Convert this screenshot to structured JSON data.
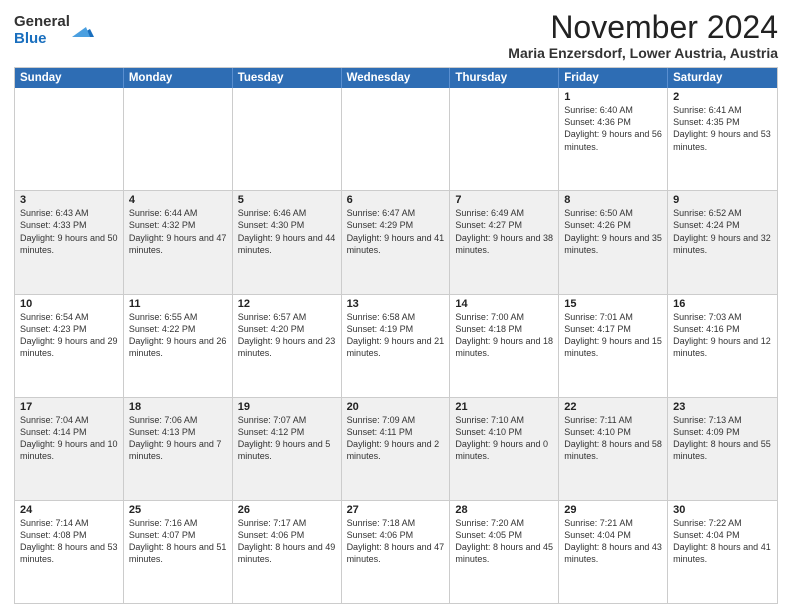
{
  "logo": {
    "general": "General",
    "blue": "Blue"
  },
  "header": {
    "month": "November 2024",
    "location": "Maria Enzersdorf, Lower Austria, Austria"
  },
  "weekdays": [
    "Sunday",
    "Monday",
    "Tuesday",
    "Wednesday",
    "Thursday",
    "Friday",
    "Saturday"
  ],
  "rows": [
    [
      {
        "day": "",
        "info": ""
      },
      {
        "day": "",
        "info": ""
      },
      {
        "day": "",
        "info": ""
      },
      {
        "day": "",
        "info": ""
      },
      {
        "day": "",
        "info": ""
      },
      {
        "day": "1",
        "info": "Sunrise: 6:40 AM\nSunset: 4:36 PM\nDaylight: 9 hours and 56 minutes."
      },
      {
        "day": "2",
        "info": "Sunrise: 6:41 AM\nSunset: 4:35 PM\nDaylight: 9 hours and 53 minutes."
      }
    ],
    [
      {
        "day": "3",
        "info": "Sunrise: 6:43 AM\nSunset: 4:33 PM\nDaylight: 9 hours and 50 minutes."
      },
      {
        "day": "4",
        "info": "Sunrise: 6:44 AM\nSunset: 4:32 PM\nDaylight: 9 hours and 47 minutes."
      },
      {
        "day": "5",
        "info": "Sunrise: 6:46 AM\nSunset: 4:30 PM\nDaylight: 9 hours and 44 minutes."
      },
      {
        "day": "6",
        "info": "Sunrise: 6:47 AM\nSunset: 4:29 PM\nDaylight: 9 hours and 41 minutes."
      },
      {
        "day": "7",
        "info": "Sunrise: 6:49 AM\nSunset: 4:27 PM\nDaylight: 9 hours and 38 minutes."
      },
      {
        "day": "8",
        "info": "Sunrise: 6:50 AM\nSunset: 4:26 PM\nDaylight: 9 hours and 35 minutes."
      },
      {
        "day": "9",
        "info": "Sunrise: 6:52 AM\nSunset: 4:24 PM\nDaylight: 9 hours and 32 minutes."
      }
    ],
    [
      {
        "day": "10",
        "info": "Sunrise: 6:54 AM\nSunset: 4:23 PM\nDaylight: 9 hours and 29 minutes."
      },
      {
        "day": "11",
        "info": "Sunrise: 6:55 AM\nSunset: 4:22 PM\nDaylight: 9 hours and 26 minutes."
      },
      {
        "day": "12",
        "info": "Sunrise: 6:57 AM\nSunset: 4:20 PM\nDaylight: 9 hours and 23 minutes."
      },
      {
        "day": "13",
        "info": "Sunrise: 6:58 AM\nSunset: 4:19 PM\nDaylight: 9 hours and 21 minutes."
      },
      {
        "day": "14",
        "info": "Sunrise: 7:00 AM\nSunset: 4:18 PM\nDaylight: 9 hours and 18 minutes."
      },
      {
        "day": "15",
        "info": "Sunrise: 7:01 AM\nSunset: 4:17 PM\nDaylight: 9 hours and 15 minutes."
      },
      {
        "day": "16",
        "info": "Sunrise: 7:03 AM\nSunset: 4:16 PM\nDaylight: 9 hours and 12 minutes."
      }
    ],
    [
      {
        "day": "17",
        "info": "Sunrise: 7:04 AM\nSunset: 4:14 PM\nDaylight: 9 hours and 10 minutes."
      },
      {
        "day": "18",
        "info": "Sunrise: 7:06 AM\nSunset: 4:13 PM\nDaylight: 9 hours and 7 minutes."
      },
      {
        "day": "19",
        "info": "Sunrise: 7:07 AM\nSunset: 4:12 PM\nDaylight: 9 hours and 5 minutes."
      },
      {
        "day": "20",
        "info": "Sunrise: 7:09 AM\nSunset: 4:11 PM\nDaylight: 9 hours and 2 minutes."
      },
      {
        "day": "21",
        "info": "Sunrise: 7:10 AM\nSunset: 4:10 PM\nDaylight: 9 hours and 0 minutes."
      },
      {
        "day": "22",
        "info": "Sunrise: 7:11 AM\nSunset: 4:10 PM\nDaylight: 8 hours and 58 minutes."
      },
      {
        "day": "23",
        "info": "Sunrise: 7:13 AM\nSunset: 4:09 PM\nDaylight: 8 hours and 55 minutes."
      }
    ],
    [
      {
        "day": "24",
        "info": "Sunrise: 7:14 AM\nSunset: 4:08 PM\nDaylight: 8 hours and 53 minutes."
      },
      {
        "day": "25",
        "info": "Sunrise: 7:16 AM\nSunset: 4:07 PM\nDaylight: 8 hours and 51 minutes."
      },
      {
        "day": "26",
        "info": "Sunrise: 7:17 AM\nSunset: 4:06 PM\nDaylight: 8 hours and 49 minutes."
      },
      {
        "day": "27",
        "info": "Sunrise: 7:18 AM\nSunset: 4:06 PM\nDaylight: 8 hours and 47 minutes."
      },
      {
        "day": "28",
        "info": "Sunrise: 7:20 AM\nSunset: 4:05 PM\nDaylight: 8 hours and 45 minutes."
      },
      {
        "day": "29",
        "info": "Sunrise: 7:21 AM\nSunset: 4:04 PM\nDaylight: 8 hours and 43 minutes."
      },
      {
        "day": "30",
        "info": "Sunrise: 7:22 AM\nSunset: 4:04 PM\nDaylight: 8 hours and 41 minutes."
      }
    ]
  ]
}
